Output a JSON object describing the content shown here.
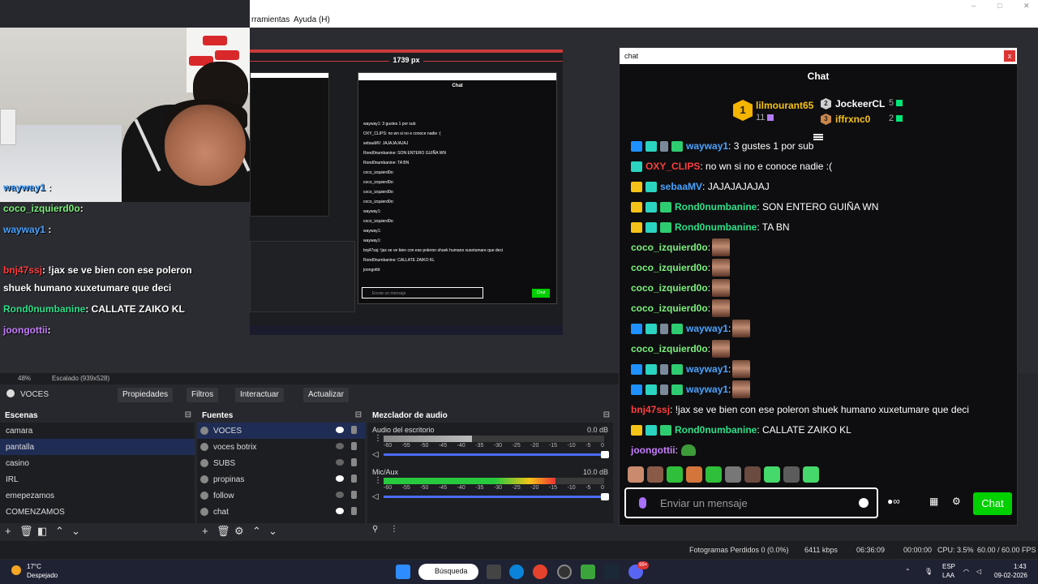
{
  "app": {
    "menu_items": [
      "rramientas",
      "Ayuda (H)"
    ],
    "window_controls": [
      "–",
      "□",
      "✕"
    ]
  },
  "nested": {
    "ruler_label": "1739 px",
    "chat_title": "Chat",
    "lines": [
      "wayway1: 3 gustes 1 por sub",
      "OXY_CLIPS: no wn si no e conoce nadie :(",
      "sebaaMV: JAJAJAJAJAJ",
      "Rond0numbanine: SON ENTERO GUIÑA WN",
      "Rond0numbanine: TA BN",
      "coco_izquierd0o:",
      "coco_izquierd0o:",
      "coco_izquierd0o:",
      "coco_izquierd0o:",
      "wayway1:",
      "coco_izquierd0o:",
      "wayway1:",
      "wayway1:",
      "bnj47ssj: !jax se ve bien con ese poleron shuek humano xuxetumare que deci",
      "Rond0numbanine: CALLATE ZAIKO KL",
      "joongottii:"
    ],
    "input_placeholder": "Enviar un mensaje",
    "chat_button": "Chat"
  },
  "overlay": {
    "lines": [
      {
        "name": "wayway1",
        "text": " :",
        "color": "#4aa3ff"
      },
      {
        "name": "coco_izquierd0o",
        "text": ":",
        "color": "#7cf07c"
      },
      {
        "name": "wayway1",
        "text": " :",
        "color": "#4aa3ff"
      },
      {
        "name": "bnj47ssj",
        "text": ": !jax se ve bien con ese poleron",
        "color": "#ff3d3d"
      },
      {
        "name": "",
        "text": "shuek humano xuxetumare que deci",
        "color": "#ffffff"
      },
      {
        "name": "Rond0numbanine",
        "text": ": CALLATE ZAIKO KL",
        "color": "#2ee08a"
      },
      {
        "name": "joongottii",
        "text": ":",
        "color": "#c77dff"
      }
    ]
  },
  "chat": {
    "window_title": "chat",
    "close": "x",
    "header": "Chat",
    "leaderboard": [
      {
        "rank": "1",
        "name": "lilmourant65",
        "count": "11",
        "color": "#f5c218"
      },
      {
        "rank": "2",
        "name": "JockeerCL",
        "count": "5",
        "color": "#ffffff"
      },
      {
        "rank": "3",
        "name": "iffrxnc0",
        "count": "2",
        "color": "#f5c218"
      }
    ],
    "messages": [
      {
        "badges": [
          "bblue",
          "bteal",
          "bgray",
          "bgreen"
        ],
        "name": "wayway1",
        "color": "#4aa3ff",
        "text": ": 3 gustes 1 por sub",
        "emotes": 0
      },
      {
        "badges": [
          "bteal"
        ],
        "name": "OXY_CLIPS",
        "color": "#ff3d3d",
        "text": ": no wn si no e conoce nadie :(",
        "emotes": 0
      },
      {
        "badges": [
          "bgold",
          "bteal"
        ],
        "name": "sebaaMV",
        "color": "#4aa3ff",
        "text": ": JAJAJAJAJAJ",
        "emotes": 0
      },
      {
        "badges": [
          "bgold",
          "bteal",
          "bgreen"
        ],
        "name": "Rond0numbanine",
        "color": "#2ee08a",
        "text": ": SON ENTERO GUIÑA WN",
        "emotes": 0
      },
      {
        "badges": [
          "bgold",
          "bteal",
          "bgreen"
        ],
        "name": "Rond0numbanine",
        "color": "#2ee08a",
        "text": ": TA BN",
        "emotes": 0
      },
      {
        "badges": [],
        "name": "coco_izquierd0o",
        "color": "#7cf07c",
        "text": ":",
        "emotes": 1
      },
      {
        "badges": [],
        "name": "coco_izquierd0o",
        "color": "#7cf07c",
        "text": ":",
        "emotes": 1
      },
      {
        "badges": [],
        "name": "coco_izquierd0o",
        "color": "#7cf07c",
        "text": ":",
        "emotes": 1
      },
      {
        "badges": [],
        "name": "coco_izquierd0o",
        "color": "#7cf07c",
        "text": ":",
        "emotes": 1
      },
      {
        "badges": [
          "bblue",
          "bteal",
          "bgray",
          "bgreen"
        ],
        "name": "wayway1",
        "color": "#4aa3ff",
        "text": ":",
        "emotes": 1
      },
      {
        "badges": [],
        "name": "coco_izquierd0o",
        "color": "#7cf07c",
        "text": ":",
        "emotes": 1
      },
      {
        "badges": [
          "bblue",
          "bteal",
          "bgray",
          "bgreen"
        ],
        "name": "wayway1",
        "color": "#4aa3ff",
        "text": ":",
        "emotes": 1
      },
      {
        "badges": [
          "bblue",
          "bteal",
          "bgray",
          "bgreen"
        ],
        "name": "wayway1",
        "color": "#4aa3ff",
        "text": ":",
        "emotes": 1
      },
      {
        "badges": [],
        "name": "bnj47ssj",
        "color": "#ff3d3d",
        "text": ": !jax se ve bien con ese poleron shuek humano xuxetumare que deci",
        "emotes": 0
      },
      {
        "badges": [
          "bgold",
          "bteal",
          "bgreen"
        ],
        "name": "Rond0numbanine",
        "color": "#2ee08a",
        "text": ": CALLATE ZAIKO KL",
        "emotes": 0
      },
      {
        "badges": [],
        "name": "joongottii",
        "color": "#c77dff",
        "text": ":",
        "emotes": 2
      }
    ],
    "emote_bar_colors": [
      "#c98a6e",
      "#8a5a48",
      "#2fbf3a",
      "#d4763c",
      "#2fbf3a",
      "#777777",
      "#6b4a40",
      "#45d86a",
      "#5c5c5c",
      "#45d86a"
    ],
    "input_placeholder": "Enviar un mensaje",
    "chat_button": "Chat"
  },
  "obs": {
    "zoom": "48%",
    "scale_label": "Escalado (939x528)",
    "source_name": "VOCES",
    "toolbar": [
      "Propiedades",
      "Filtros",
      "Interactuar",
      "Actualizar"
    ],
    "scenes_title": "Escenas",
    "scenes": [
      "camara",
      "pantalla",
      "casino",
      "IRL",
      "emepezamos",
      "COMENZAMOS"
    ],
    "selected_scene": 1,
    "sources_title": "Fuentes",
    "sources": [
      {
        "name": "VOCES",
        "visible": true
      },
      {
        "name": "voces botrix",
        "visible": false
      },
      {
        "name": "SUBS",
        "visible": false
      },
      {
        "name": "propinas",
        "visible": true
      },
      {
        "name": "follow",
        "visible": false
      },
      {
        "name": "chat",
        "visible": true
      }
    ],
    "mixer_title": "Mezclador de audio",
    "mixer": [
      {
        "name": "Audio del escritorio",
        "value": "0.0 dB",
        "level": 0.4
      },
      {
        "name": "Mic/Aux",
        "value": "10.0 dB",
        "level": 0.78
      }
    ],
    "scale_ticks": [
      "-60",
      "-55",
      "-50",
      "-45",
      "-40",
      "-35",
      "-30",
      "-25",
      "-20",
      "-15",
      "-10",
      "-5",
      "0"
    ]
  },
  "status": {
    "frames_lost": "Fotogramas Perdidos 0 (0.0%)",
    "bitrate": "6411 kbps",
    "live_time": "06:36:09",
    "rec_time": "00:00:00",
    "cpu": "CPU: 3.5%",
    "fps": "60.00 / 60.00 FPS"
  },
  "taskbar": {
    "weather_temp": "17°C",
    "weather_desc": "Despejado",
    "search": "Búsqueda",
    "lang1": "ESP",
    "lang2": "LAA",
    "time": "1:43",
    "date": "09-02-2026",
    "badge": "99+"
  },
  "colors": {
    "accent_chat": "#00d000",
    "obs_selected": "#1f2d55"
  }
}
